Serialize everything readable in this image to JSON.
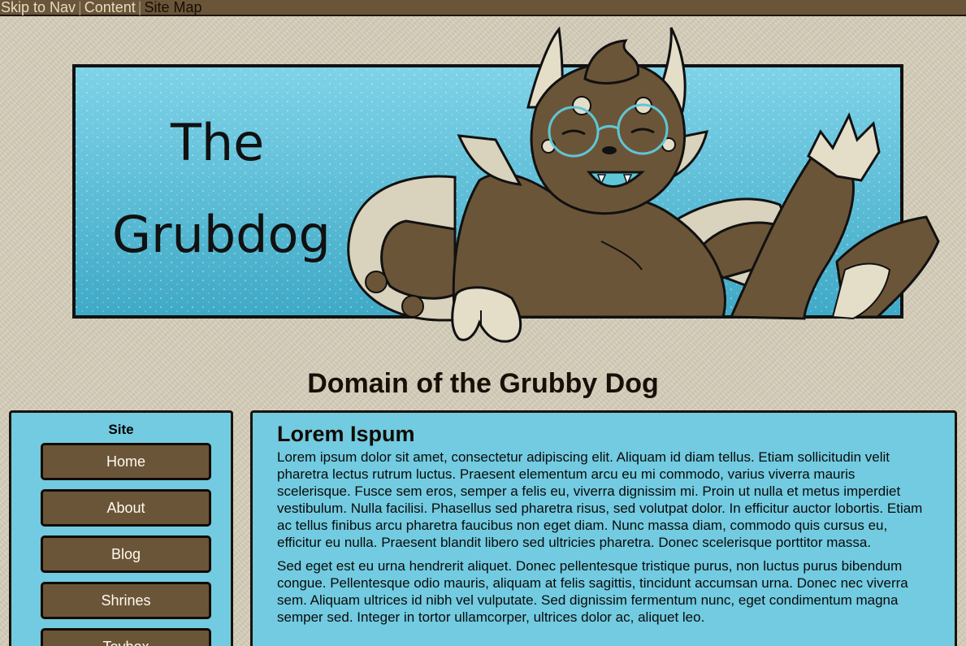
{
  "skip_nav": {
    "links": [
      {
        "label": "Skip to Nav"
      },
      {
        "label": "Content"
      },
      {
        "label": "Site Map"
      }
    ],
    "separator": "|"
  },
  "banner": {
    "title_line1": "The",
    "title_line2": "Grubdog",
    "colors": {
      "sky": "#5ec4dc",
      "fur": "#6b5538",
      "cream": "#d9d2bc",
      "lens": "#5fc6d6"
    }
  },
  "site_title": "Domain of the Grubby Dog",
  "sidebar": {
    "heading": "Site",
    "items": [
      {
        "label": "Home"
      },
      {
        "label": "About"
      },
      {
        "label": "Blog"
      },
      {
        "label": "Shrines"
      },
      {
        "label": "Toybox"
      }
    ]
  },
  "content": {
    "heading": "Lorem Ispum",
    "paragraphs": [
      "Lorem ipsum dolor sit amet, consectetur adipiscing elit. Aliquam id diam tellus. Etiam sollicitudin velit pharetra lectus rutrum luctus. Praesent elementum arcu eu mi commodo, varius viverra mauris scelerisque. Fusce sem eros, semper a felis eu, viverra dignissim mi. Proin ut nulla et metus imperdiet vestibulum. Nulla facilisi. Phasellus sed pharetra risus, sed volutpat dolor. In efficitur auctor lobortis. Etiam ac tellus finibus arcu pharetra faucibus non eget diam. Nunc massa diam, commodo quis cursus eu, efficitur eu nulla. Praesent blandit libero sed ultricies pharetra. Donec scelerisque porttitor massa.",
      "Sed eget est eu urna hendrerit aliquet. Donec pellentesque tristique purus, non luctus purus bibendum congue. Pellentesque odio mauris, aliquam at felis sagittis, tincidunt accumsan urna. Donec nec viverra sem. Aliquam ultrices id nibh vel vulputate. Sed dignissim fermentum nunc, eget condimentum magna semper sed. Integer in tortor ullamcorper, ultrices dolor ac, aliquet leo."
    ]
  },
  "colors": {
    "page_bg": "#d4cdb9",
    "panel_bg": "#72cbe0",
    "button_bg": "#6b5538",
    "border": "#1b1208"
  }
}
